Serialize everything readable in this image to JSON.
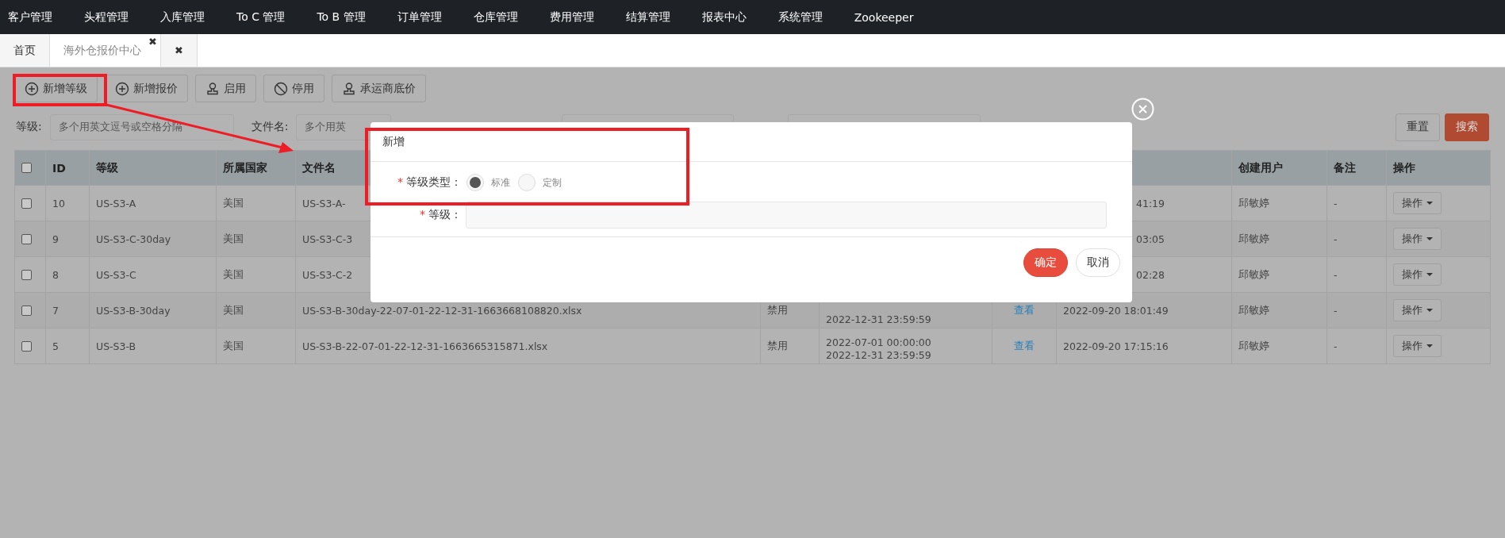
{
  "nav": {
    "items": [
      "客户管理",
      "头程管理",
      "入库管理",
      "To C 管理",
      "To B 管理",
      "订单管理",
      "仓库管理",
      "费用管理",
      "结算管理",
      "报表中心",
      "系统管理",
      "Zookeeper"
    ]
  },
  "tabs": [
    {
      "label": "首页",
      "selected": false
    },
    {
      "label": "海外仓报价中心",
      "selected": true,
      "close": "✖"
    },
    {
      "close": "✖",
      "selected": false
    }
  ],
  "toolbar": {
    "buttons": [
      {
        "label": "新增等级",
        "kind": "plus"
      },
      {
        "label": "新增报价",
        "kind": "plus"
      },
      {
        "label": "启用",
        "kind": "stamp"
      },
      {
        "label": "停用",
        "kind": "ban"
      },
      {
        "label": "承运商底价",
        "kind": "stamp"
      }
    ]
  },
  "filters": [
    {
      "kind": "text",
      "label": "等级:",
      "placeholder": "多个用英文逗号或空格分隔"
    },
    {
      "kind": "text",
      "label": "文件名:",
      "placeholder": "多个用英"
    },
    {
      "kind": "select"
    },
    {
      "kind": "select"
    }
  ],
  "filter_buttons": [
    {
      "label": "重置",
      "kind": "default"
    },
    {
      "label": "搜索",
      "kind": "primary"
    }
  ],
  "table": {
    "header_checked": false,
    "columns": {
      "id": "ID",
      "level": "等级",
      "country": "所属国家",
      "file": "文件名",
      "user": "创建用户",
      "note": "备注",
      "action": "操作"
    },
    "rows": [
      {
        "checked": false,
        "id": "10",
        "level": "US-S3-A",
        "country": "美国",
        "file": "US-S3-A-",
        "created": "41:19",
        "user": "邱敏婷",
        "note": "-",
        "action": "操作"
      },
      {
        "checked": false,
        "id": "9",
        "level": "US-S3-C-30day",
        "country": "美国",
        "file": "US-S3-C-3",
        "created": "03:05",
        "user": "邱敏婷",
        "note": "-",
        "action": "操作"
      },
      {
        "checked": false,
        "id": "8",
        "level": "US-S3-C",
        "country": "美国",
        "file": "US-S3-C-2",
        "created": "02:28",
        "user": "邱敏婷",
        "note": "-",
        "action": "操作"
      },
      {
        "checked": false,
        "id": "7",
        "level": "US-S3-B-30day",
        "country": "美国",
        "file": "US-S3-B-30day-22-07-01-22-12-31-1663668108820.xlsx",
        "status": "禁用",
        "validity": [
          "2022-12-31 23:59:59"
        ],
        "link": "查看",
        "created": "2022-09-20 18:01:49",
        "user": "邱敏婷",
        "note": "-",
        "action": "操作"
      },
      {
        "checked": false,
        "id": "5",
        "level": "US-S3-B",
        "country": "美国",
        "file": "US-S3-B-22-07-01-22-12-31-1663665315871.xlsx",
        "status": "禁用",
        "validity": [
          "2022-07-01 00:00:00",
          "2022-12-31 23:59:59"
        ],
        "link": "查看",
        "created": "2022-09-20 17:15:16",
        "user": "邱敏婷",
        "note": "-",
        "action": "操作"
      }
    ]
  },
  "modal": {
    "title": "新增",
    "fields": [
      {
        "kind": "radio",
        "mark": "*",
        "label": "等级类型：",
        "options": [
          {
            "label": "标准",
            "selected": true
          },
          {
            "label": "定制",
            "selected": false
          }
        ]
      },
      {
        "kind": "input",
        "mark": "*",
        "label": "等级："
      }
    ],
    "buttons": [
      {
        "label": "确定",
        "kind": "primary"
      },
      {
        "label": "取消",
        "kind": "default"
      }
    ]
  }
}
